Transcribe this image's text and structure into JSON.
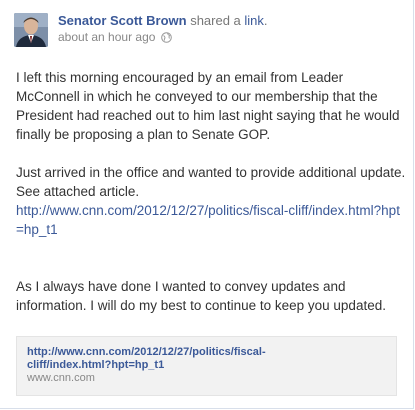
{
  "post": {
    "author_name": "Senator Scott Brown",
    "shared_prefix": " shared a ",
    "shared_link_word": "link",
    "shared_suffix": ".",
    "timestamp": "about an hour ago",
    "privacy_icon": "globe-icon",
    "paragraph_1": "I left this morning encouraged by an email from Leader McConnell in which he conveyed to our membership that the President had reached out to him last night saying that he would finally be proposing a plan to Senate GOP.",
    "paragraph_2": "Just arrived in the office and wanted to provide additional update. See attached article.",
    "paragraph_2_link": "http://www.cnn.com/2012/12/27/politics/fiscal-cliff/index.html?hpt=hp_t1",
    "paragraph_3": "As I always have done I wanted to convey updates and information. I will do my best to continue to keep you updated."
  },
  "attachment": {
    "url_line_1": "http://www.cnn.com/2012/12/27/politics/fiscal-",
    "url_line_2": "cliff/index.html?hpt=hp_t1",
    "domain": "www.cnn.com"
  },
  "colors": {
    "link": "#3b5998",
    "meta": "#888888",
    "text": "#333333",
    "attachment_bg": "#f2f2f2"
  }
}
